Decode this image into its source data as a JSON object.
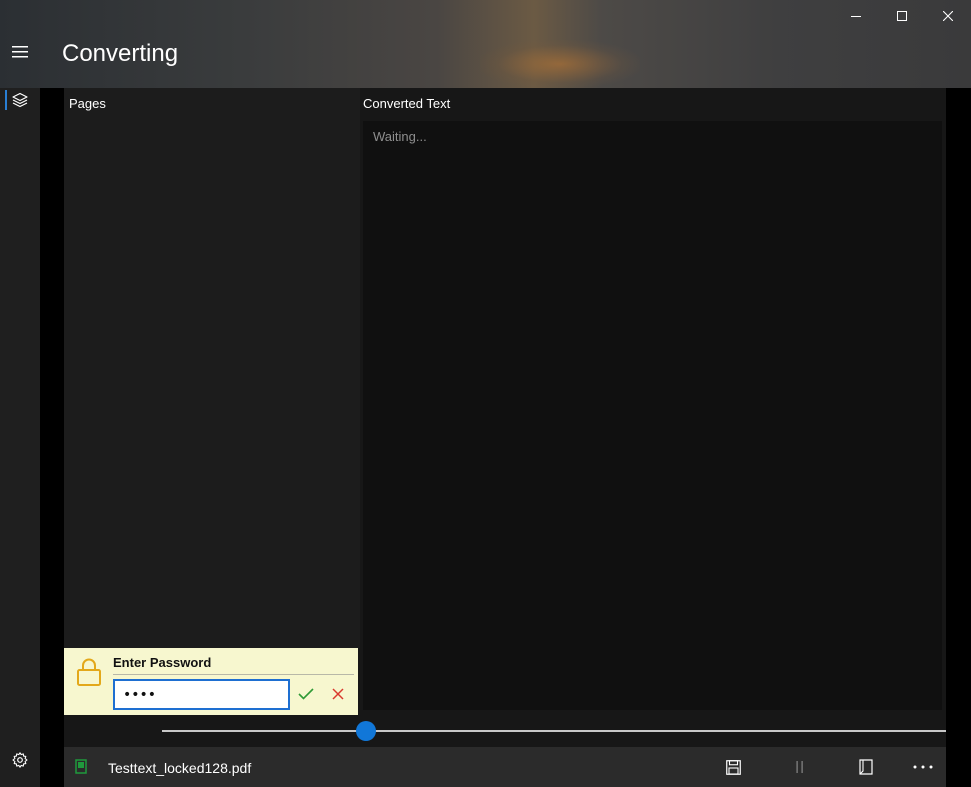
{
  "window": {
    "title": "Converting"
  },
  "panes": {
    "pages_label": "Pages",
    "converted_label": "Converted Text",
    "converted_placeholder": "Waiting..."
  },
  "password_prompt": {
    "title": "Enter Password",
    "masked_value": "••••",
    "ok_icon": "checkmark-icon",
    "cancel_icon": "close-icon",
    "lock_icon": "lock-icon"
  },
  "slider": {
    "value_fraction": 0.26
  },
  "status_bar": {
    "file_name": "Testtext_locked128.pdf",
    "icons": [
      "file-icon",
      "save-icon",
      "pause-icon",
      "two-page-icon",
      "more-icon"
    ]
  },
  "colors": {
    "accent": "#1177d8",
    "prompt_background": "#f7f7cf",
    "lock_icon": "#e3a81a",
    "ok": "#2f9a36",
    "cancel": "#d93a2e",
    "file_icon": "#1f9a3c"
  }
}
